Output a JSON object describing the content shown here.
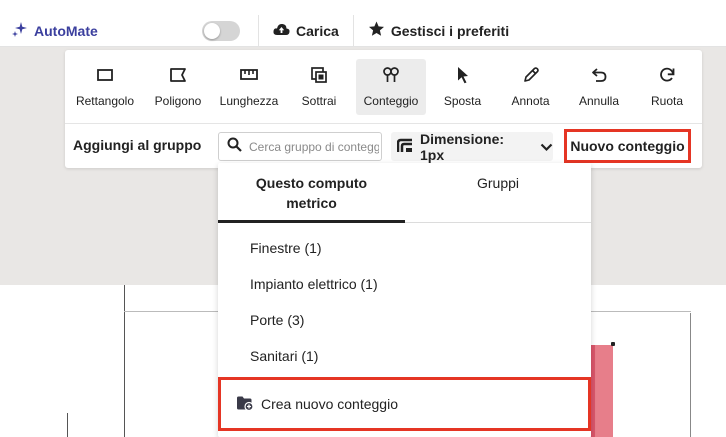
{
  "header": {
    "automate_label": "AutoMate",
    "upload_label": "Carica",
    "favorites_label": "Gestisci i preferiti",
    "toggle_on": false
  },
  "toolbar": {
    "tools": [
      {
        "label": "Rettangolo",
        "icon": "rectangle-icon"
      },
      {
        "label": "Poligono",
        "icon": "polygon-icon"
      },
      {
        "label": "Lunghezza",
        "icon": "ruler-icon"
      },
      {
        "label": "Sottrai",
        "icon": "subtract-icon"
      },
      {
        "label": "Conteggio",
        "icon": "count-icon",
        "active": true
      },
      {
        "label": "Sposta",
        "icon": "cursor-icon"
      },
      {
        "label": "Annota",
        "icon": "pen-icon"
      },
      {
        "label": "Annulla",
        "icon": "undo-icon"
      },
      {
        "label": "Ruota",
        "icon": "rotate-icon"
      }
    ]
  },
  "group_row": {
    "label": "Aggiungi al gruppo",
    "search_placeholder": "Cerca gruppo di conteggio",
    "dimension_label": "Dimensione: 1px",
    "new_count_label": "Nuovo conteggio"
  },
  "dropdown": {
    "tab_active": "Questo computo metrico",
    "tab_other": "Gruppi",
    "items": [
      "Finestre (1)",
      "Impianto elettrico (1)",
      "Porte (3)",
      "Sanitari (1)"
    ],
    "create_label": "Crea nuovo conteggio"
  },
  "colors": {
    "accent": "#3b3f9e",
    "highlight": "#e53524",
    "drawing_fill": "#e77e8a"
  }
}
